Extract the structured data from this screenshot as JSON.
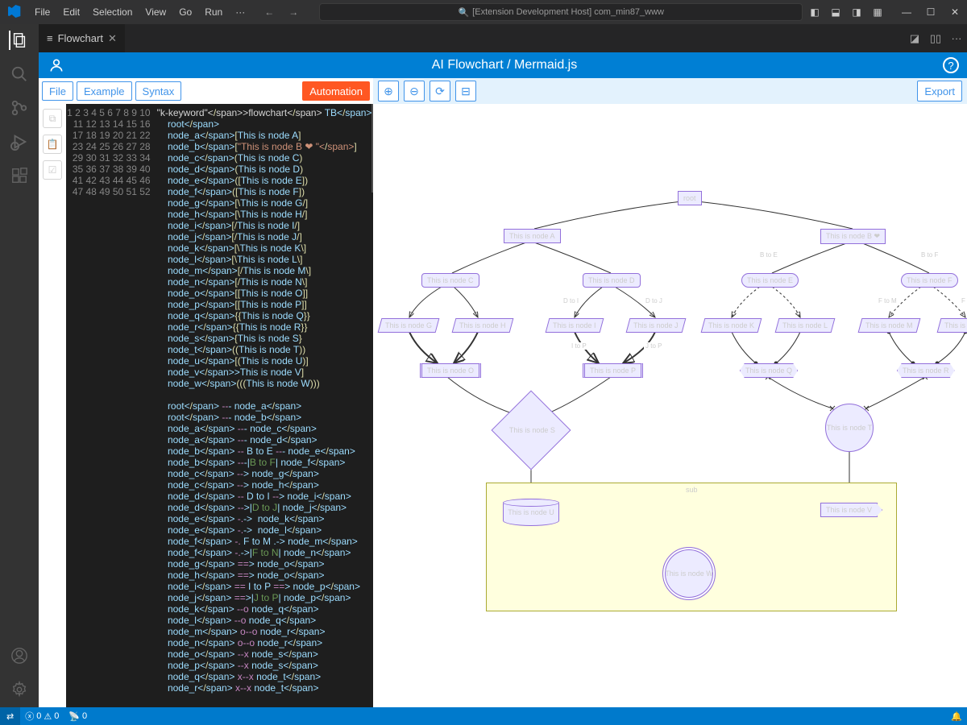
{
  "titlebar": {
    "menu": [
      "File",
      "Edit",
      "Selection",
      "View",
      "Go",
      "Run"
    ],
    "search": "[Extension Development Host] com_min87_www"
  },
  "tab": {
    "label": "Flowchart"
  },
  "panel": {
    "title": "AI Flowchart / Mermaid.js"
  },
  "left_toolbar": {
    "file": "File",
    "example": "Example",
    "syntax": "Syntax",
    "automation": "Automation"
  },
  "right_toolbar": {
    "export": "Export"
  },
  "statusbar": {
    "errors": "0",
    "warnings": "0",
    "port": "0"
  },
  "code": {
    "lines": [
      "flowchart TB",
      "    root",
      "    node_a[This is node A]",
      "    node_b[\"This is node B ❤ \"]",
      "    node_c(This is node C)",
      "    node_d(This is node D)",
      "    node_e([This is node E])",
      "    node_f([This is node F])",
      "    node_g[\\This is node G/]",
      "    node_h[\\This is node H/]",
      "    node_i[/This is node I/]",
      "    node_j[/This is node J/]",
      "    node_k[\\This is node K\\]",
      "    node_l[\\This is node L\\]",
      "    node_m[/This is node M\\]",
      "    node_n[/This is node N\\]",
      "    node_o[[This is node O]]",
      "    node_p[[This is node P]]",
      "    node_q{{This is node Q}}",
      "    node_r{{This is node R}}",
      "    node_s{This is node S}",
      "    node_t((This is node T))",
      "    node_u[(This is node U)]",
      "    node_v>This is node V]",
      "    node_w(((This is node W)))",
      "",
      "    root --- node_a",
      "    root --- node_b",
      "    node_a --- node_c",
      "    node_a --- node_d",
      "    node_b -- B to E --- node_e",
      "    node_b ---|B to F| node_f",
      "    node_c --> node_g",
      "    node_c --> node_h",
      "    node_d -- D to I --> node_i",
      "    node_d -->|D to J| node_j",
      "    node_e -.->  node_k",
      "    node_e -.->  node_l",
      "    node_f -. F to M .-> node_m",
      "    node_f -.->|F to N| node_n",
      "    node_g ==> node_o",
      "    node_h ==> node_o",
      "    node_i == I to P ==> node_p",
      "    node_j ==>|J to P| node_p",
      "    node_k --o node_q",
      "    node_l --o node_q",
      "    node_m o--o node_r",
      "    node_n o--o node_r",
      "    node_o --x node_s",
      "    node_p --x node_s",
      "    node_q x--x node_t",
      "    node_r x--x node_t"
    ]
  },
  "diagram": {
    "nodes": {
      "root": "root",
      "A": "This is node A",
      "B": "This is node B ❤",
      "C": "This is node C",
      "D": "This is node D",
      "E": "This is node E",
      "F": "This is node F",
      "G": "This is node G",
      "H": "This is node H",
      "I": "This is node I",
      "J": "This is node J",
      "K": "This is node K",
      "L": "This is node L",
      "M": "This is node M",
      "N": "This is node N",
      "O": "This is node O",
      "P": "This is node P",
      "Q": "This is node Q",
      "R": "This is node R",
      "S": "This is node S",
      "T": "This is node T",
      "U": "This is node U",
      "V": "This is node V",
      "W": "This is node W"
    },
    "edges": {
      "BtoE": "B to E",
      "BtoF": "B to F",
      "DtoI": "D to I",
      "DtoJ": "D to J",
      "FtoM": "F to M",
      "FtoN": "F to N",
      "ItoP": "I to P",
      "JtoP": "J to P"
    },
    "sub": "sub"
  },
  "chart_data": {
    "type": "flowchart",
    "direction": "TB",
    "nodes": [
      {
        "id": "root",
        "label": "root",
        "shape": "rect"
      },
      {
        "id": "node_a",
        "label": "This is node A",
        "shape": "rect"
      },
      {
        "id": "node_b",
        "label": "This is node B ❤",
        "shape": "rect"
      },
      {
        "id": "node_c",
        "label": "This is node C",
        "shape": "round"
      },
      {
        "id": "node_d",
        "label": "This is node D",
        "shape": "round"
      },
      {
        "id": "node_e",
        "label": "This is node E",
        "shape": "stadium"
      },
      {
        "id": "node_f",
        "label": "This is node F",
        "shape": "stadium"
      },
      {
        "id": "node_g",
        "label": "This is node G",
        "shape": "trapezoid"
      },
      {
        "id": "node_h",
        "label": "This is node H",
        "shape": "trapezoid"
      },
      {
        "id": "node_i",
        "label": "This is node I",
        "shape": "lean-right"
      },
      {
        "id": "node_j",
        "label": "This is node J",
        "shape": "lean-right"
      },
      {
        "id": "node_k",
        "label": "This is node K",
        "shape": "lean-left"
      },
      {
        "id": "node_l",
        "label": "This is node L",
        "shape": "lean-left"
      },
      {
        "id": "node_m",
        "label": "This is node M",
        "shape": "trapezoid-alt"
      },
      {
        "id": "node_n",
        "label": "This is node N",
        "shape": "trapezoid-alt"
      },
      {
        "id": "node_o",
        "label": "This is node O",
        "shape": "subroutine"
      },
      {
        "id": "node_p",
        "label": "This is node P",
        "shape": "subroutine"
      },
      {
        "id": "node_q",
        "label": "This is node Q",
        "shape": "hexagon"
      },
      {
        "id": "node_r",
        "label": "This is node R",
        "shape": "hexagon"
      },
      {
        "id": "node_s",
        "label": "This is node S",
        "shape": "diamond"
      },
      {
        "id": "node_t",
        "label": "This is node T",
        "shape": "circle"
      },
      {
        "id": "node_u",
        "label": "This is node U",
        "shape": "cylinder"
      },
      {
        "id": "node_v",
        "label": "This is node V",
        "shape": "asymmetric"
      },
      {
        "id": "node_w",
        "label": "This is node W",
        "shape": "double-circle"
      }
    ],
    "edges": [
      {
        "from": "root",
        "to": "node_a",
        "style": "line"
      },
      {
        "from": "root",
        "to": "node_b",
        "style": "line"
      },
      {
        "from": "node_a",
        "to": "node_c",
        "style": "line"
      },
      {
        "from": "node_a",
        "to": "node_d",
        "style": "line"
      },
      {
        "from": "node_b",
        "to": "node_e",
        "style": "line",
        "label": "B to E"
      },
      {
        "from": "node_b",
        "to": "node_f",
        "style": "line",
        "label": "B to F"
      },
      {
        "from": "node_c",
        "to": "node_g",
        "style": "arrow"
      },
      {
        "from": "node_c",
        "to": "node_h",
        "style": "arrow"
      },
      {
        "from": "node_d",
        "to": "node_i",
        "style": "arrow",
        "label": "D to I"
      },
      {
        "from": "node_d",
        "to": "node_j",
        "style": "arrow",
        "label": "D to J"
      },
      {
        "from": "node_e",
        "to": "node_k",
        "style": "dotted-arrow"
      },
      {
        "from": "node_e",
        "to": "node_l",
        "style": "dotted-arrow"
      },
      {
        "from": "node_f",
        "to": "node_m",
        "style": "dotted-arrow",
        "label": "F to M"
      },
      {
        "from": "node_f",
        "to": "node_n",
        "style": "dotted-arrow",
        "label": "F to N"
      },
      {
        "from": "node_g",
        "to": "node_o",
        "style": "thick-arrow"
      },
      {
        "from": "node_h",
        "to": "node_o",
        "style": "thick-arrow"
      },
      {
        "from": "node_i",
        "to": "node_p",
        "style": "thick-arrow",
        "label": "I to P"
      },
      {
        "from": "node_j",
        "to": "node_p",
        "style": "thick-arrow",
        "label": "J to P"
      },
      {
        "from": "node_k",
        "to": "node_q",
        "style": "circle-end"
      },
      {
        "from": "node_l",
        "to": "node_q",
        "style": "circle-end"
      },
      {
        "from": "node_m",
        "to": "node_r",
        "style": "circle-both"
      },
      {
        "from": "node_n",
        "to": "node_r",
        "style": "circle-both"
      },
      {
        "from": "node_o",
        "to": "node_s",
        "style": "cross-end"
      },
      {
        "from": "node_p",
        "to": "node_s",
        "style": "cross-end"
      },
      {
        "from": "node_q",
        "to": "node_t",
        "style": "cross-both"
      },
      {
        "from": "node_r",
        "to": "node_t",
        "style": "cross-both"
      },
      {
        "from": "node_s",
        "to": "node_u",
        "style": "arrow-both"
      },
      {
        "from": "node_t",
        "to": "node_v",
        "style": "arrow-both"
      },
      {
        "from": "node_u",
        "to": "node_w",
        "style": "line"
      },
      {
        "from": "node_v",
        "to": "node_w",
        "style": "line"
      }
    ],
    "subgraphs": [
      {
        "id": "sub",
        "label": "sub",
        "nodes": [
          "node_u",
          "node_v",
          "node_w"
        ]
      }
    ]
  }
}
